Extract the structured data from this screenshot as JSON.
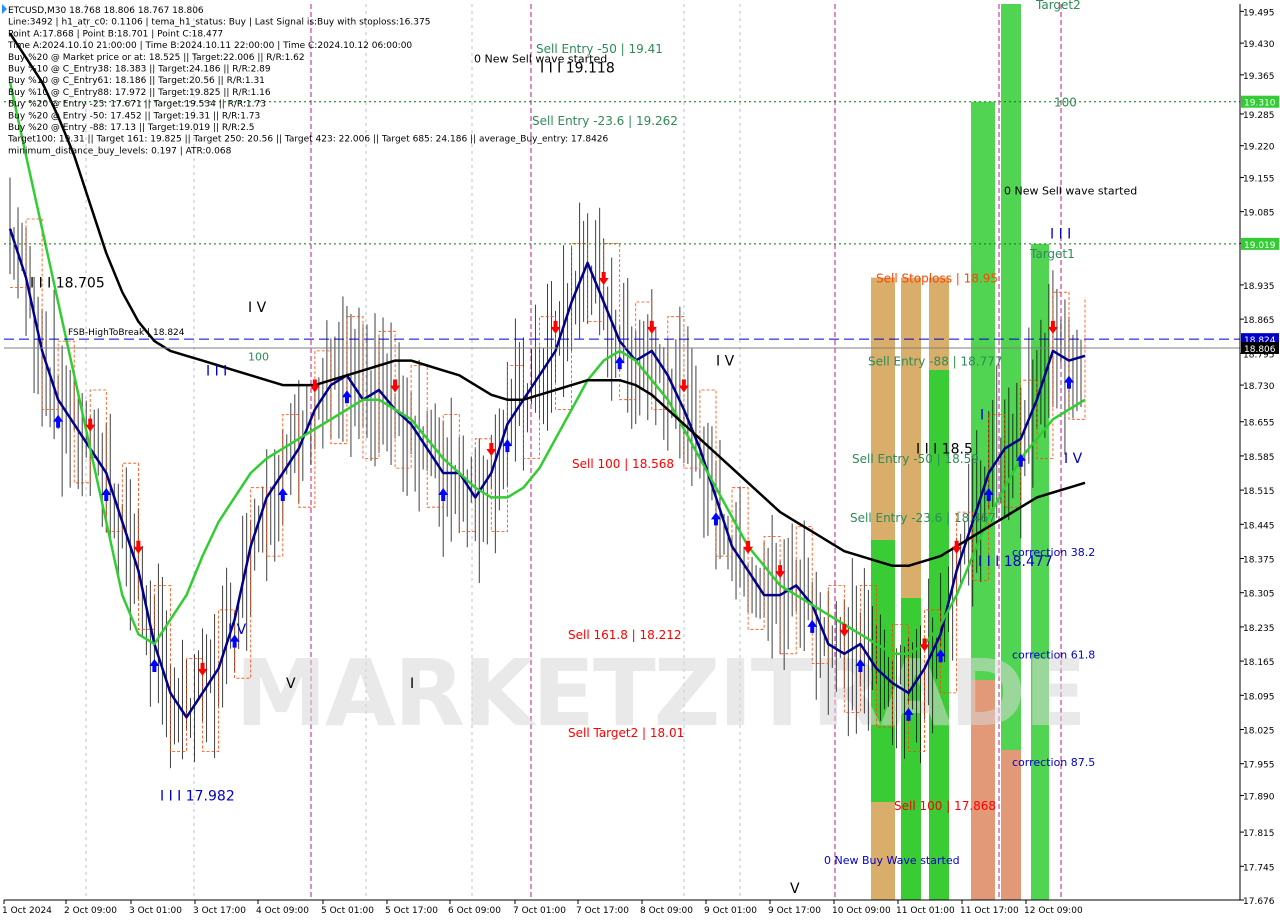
{
  "header": {
    "lines": [
      "ETCUSD,M30  18.768 18.806 18.767 18.806",
      "Line:3492 | h1_atr_c0: 0.1106 | tema_h1_status: Buy | Last Signal is:Buy with stoploss:16.375",
      "Point A:17.868 | Point B:18.701 | Point C:18.477",
      "Time A:2024.10.10 21:00:00 | Time B:2024.10.11 22:00:00 | Time C:2024.10.12 06:00:00",
      "Buy %20 @ Market price or at: 18.525 || Target:22.006 || R/R:1.62",
      "Buy %10 @ C_Entry38: 18.383 || Target:24.186 || R/R:2.89",
      "Buy %10 @ C_Entry61: 18.186 || Target:20.56 || R/R:1.31",
      "Buy %10 @ C_Entry88: 17.972 || Target:19.825 || R/R:1.16",
      "Buy %20 @ Entry -23: 17.671 || Target:19.534 || R/R:1.73",
      "Buy %20 @ Entry -50: 17.452 || Target:19.31 || R/R:1.73",
      "Buy %20 @ Entry -88: 17.13 || Target:19.019 || R/R:2.5",
      "Target100: 19.31 || Target 161: 19.825 || Target 250: 20.56 || Target 423: 22.006 || Target 685: 24.186 || average_Buy_entry: 17.8426",
      "minimum_distance_buy_levels: 0.197 | ATR:0.068"
    ]
  },
  "watermark": "MARKETZITRADE",
  "colors": {
    "bull_candle": "#000000",
    "ma_fast": "#00008b",
    "ma_mid": "#32cd32",
    "ma_slow": "#000000",
    "fractal_line": "#ff4500",
    "level_blue": "#0000cd",
    "level_green": "#008000",
    "zone_green": "#32cd32",
    "zone_orange": "#d2a050",
    "zone_salmon": "#e9967a",
    "separator": "#c71585",
    "arrow_buy": "#0000ff",
    "arrow_sell": "#ff0000"
  },
  "chart_data": {
    "type": "line",
    "symbol": "ETCUSD",
    "timeframe": "M30",
    "ylim": [
      17.676,
      19.51
    ],
    "price_axis": {
      "ticks": [
        "19.495",
        "19.430",
        "19.365",
        "19.285",
        "19.220",
        "19.155",
        "19.085",
        "19.020",
        "18.935",
        "18.865",
        "18.795",
        "18.730",
        "18.655",
        "18.585",
        "18.515",
        "18.445",
        "18.375",
        "18.305",
        "18.235",
        "18.165",
        "18.095",
        "18.025",
        "17.955",
        "17.890",
        "17.815",
        "17.745",
        "17.676"
      ],
      "tick_values": [
        19.495,
        19.43,
        19.365,
        19.285,
        19.22,
        19.155,
        19.085,
        19.02,
        18.935,
        18.865,
        18.795,
        18.73,
        18.655,
        18.585,
        18.515,
        18.445,
        18.375,
        18.305,
        18.235,
        18.165,
        18.095,
        18.025,
        17.955,
        17.89,
        17.815,
        17.745,
        17.676
      ],
      "badges": [
        {
          "text": "19.310",
          "value": 19.31,
          "color": "#32cd32"
        },
        {
          "text": "19.019",
          "value": 19.019,
          "color": "#32cd32"
        },
        {
          "text": "18.824",
          "value": 18.824,
          "color": "#0000cd"
        },
        {
          "text": "18.806",
          "value": 18.806,
          "color": "#000000"
        }
      ]
    },
    "time_axis": {
      "labels": [
        "1 Oct 2024",
        "2 Oct 09:00",
        "3 Oct 01:00",
        "3 Oct 17:00",
        "4 Oct 09:00",
        "5 Oct 01:00",
        "5 Oct 17:00",
        "6 Oct 09:00",
        "7 Oct 01:00",
        "7 Oct 17:00",
        "8 Oct 09:00",
        "9 Oct 01:00",
        "9 Oct 17:00",
        "10 Oct 09:00",
        "11 Oct 01:00",
        "11 Oct 17:00",
        "12 Oct 09:00"
      ]
    },
    "levels": [
      {
        "label": "FSB-HighToBreak | 18.824",
        "value": 18.824,
        "color": "#0000cd",
        "style": "dashed"
      },
      {
        "label": "",
        "value": 19.31,
        "color": "#008000",
        "style": "dotted"
      },
      {
        "label": "",
        "value": 19.019,
        "color": "#008000",
        "style": "dotted"
      },
      {
        "label": "",
        "value": 18.806,
        "color": "#808080",
        "style": "solid"
      }
    ],
    "series": [
      {
        "values": [
          19.05,
          18.95,
          18.8,
          18.7,
          18.65,
          18.6,
          18.55,
          18.45,
          18.35,
          18.2,
          18.1,
          18.05,
          18.1,
          18.15,
          18.25,
          18.4,
          18.5,
          18.55,
          18.6,
          18.68,
          18.73,
          18.75,
          18.7,
          18.72,
          18.68,
          18.65,
          18.6,
          18.55,
          18.55,
          18.5,
          18.55,
          18.65,
          18.7,
          18.75,
          18.8,
          18.9,
          18.98,
          18.9,
          18.82,
          18.78,
          18.8,
          18.75,
          18.68,
          18.6,
          18.5,
          18.4,
          18.35,
          18.3,
          18.3,
          18.32,
          18.28,
          18.2,
          18.18,
          18.2,
          18.15,
          18.12,
          18.1,
          18.15,
          18.22,
          18.35,
          18.45,
          18.55,
          18.6,
          18.62,
          18.7,
          18.8,
          18.78,
          18.79
        ]
      },
      {
        "values": [
          19.35,
          19.2,
          19.05,
          18.9,
          18.75,
          18.6,
          18.45,
          18.3,
          18.22,
          18.2,
          18.25,
          18.3,
          18.38,
          18.45,
          18.5,
          18.55,
          18.58,
          18.6,
          18.62,
          18.64,
          18.66,
          18.68,
          18.7,
          18.7,
          18.68,
          18.66,
          18.62,
          18.58,
          18.55,
          18.52,
          18.5,
          18.5,
          18.52,
          18.56,
          18.62,
          18.68,
          18.74,
          18.78,
          18.8,
          18.78,
          18.74,
          18.7,
          18.64,
          18.58,
          18.52,
          18.46,
          18.4,
          18.36,
          18.32,
          18.3,
          18.28,
          18.26,
          18.24,
          18.22,
          18.2,
          18.18,
          18.18,
          18.2,
          18.24,
          18.3,
          18.38,
          18.46,
          18.52,
          18.58,
          18.62,
          18.66,
          18.68,
          18.7
        ]
      },
      {
        "values": [
          19.45,
          19.4,
          19.35,
          19.28,
          19.2,
          19.1,
          19.0,
          18.92,
          18.86,
          18.82,
          18.8,
          18.79,
          18.78,
          18.77,
          18.76,
          18.75,
          18.74,
          18.73,
          18.73,
          18.73,
          18.74,
          18.75,
          18.76,
          18.77,
          18.78,
          18.78,
          18.77,
          18.76,
          18.75,
          18.73,
          18.71,
          18.7,
          18.7,
          18.71,
          18.72,
          18.73,
          18.74,
          18.74,
          18.74,
          18.73,
          18.71,
          18.68,
          18.65,
          18.62,
          18.59,
          18.56,
          18.53,
          18.5,
          18.47,
          18.45,
          18.43,
          18.41,
          18.39,
          18.38,
          18.37,
          18.36,
          18.36,
          18.37,
          18.38,
          18.4,
          18.42,
          18.44,
          18.46,
          18.48,
          18.5,
          18.51,
          18.52,
          18.53
        ]
      }
    ],
    "zones": [
      {
        "top": 18.95,
        "bottom": 17.676,
        "color": "#d2a050"
      },
      {
        "top": 18.95,
        "bottom": 17.676,
        "color": "#d2a050"
      },
      {
        "top": 18.95,
        "bottom": 17.676,
        "color": "#d2a050"
      },
      {
        "top": 19.31,
        "bottom": 17.676,
        "color": "#32cd32"
      },
      {
        "top": 19.51,
        "bottom": 17.676,
        "color": "#32cd32"
      },
      {
        "top": 19.019,
        "bottom": 17.676,
        "color": "#32cd32"
      }
    ],
    "annotations": [
      {
        "text": "Sell Entry -50 | 19.41",
        "value": 19.41,
        "color": "#2e8b57"
      },
      {
        "text": "0 New Sell wave started",
        "value": 19.39,
        "color": "#000000"
      },
      {
        "text": "I I I 19.118",
        "value": 19.37,
        "color": "#000000"
      },
      {
        "text": "Sell Entry -23.6 | 19.262",
        "value": 19.262,
        "color": "#2e8b57"
      },
      {
        "text": "Target2",
        "value": 19.5,
        "color": "#2e8b57"
      },
      {
        "text": "100",
        "value": 19.3,
        "color": "#2e8b57"
      },
      {
        "text": "0 New Sell wave started",
        "value": 19.12,
        "color": "#000000"
      },
      {
        "text": "I I I",
        "value": 19.03,
        "color": "#0000cd"
      },
      {
        "text": "Target1",
        "value": 18.99,
        "color": "#2e8b57"
      },
      {
        "text": "I I I 18.705",
        "value": 18.93,
        "color": "#000000"
      },
      {
        "text": "I V",
        "value": 18.88,
        "color": "#000000"
      },
      {
        "text": "Sell Stoploss | 18.95",
        "value": 18.94,
        "color": "#ff4500"
      },
      {
        "text": "100",
        "value": 18.78,
        "color": "#2e8b57"
      },
      {
        "text": "I I I",
        "value": 18.75,
        "color": "#0000cd"
      },
      {
        "text": "I V",
        "value": 18.77,
        "color": "#000000"
      },
      {
        "text": "Sell Entry -88 | 18.777",
        "value": 18.77,
        "color": "#2e8b57"
      },
      {
        "text": "I",
        "value": 18.66,
        "color": "#0000cd"
      },
      {
        "text": "Sell 100 | 18.568",
        "value": 18.56,
        "color": "#ff0000"
      },
      {
        "text": "I I I 18.5",
        "value": 18.59,
        "color": "#000000"
      },
      {
        "text": "Sell Entry -50 | 18.59",
        "value": 18.57,
        "color": "#2e8b57"
      },
      {
        "text": "I V",
        "value": 18.57,
        "color": "#0000cd"
      },
      {
        "text": "Sell Entry -23.6 | 18.467",
        "value": 18.45,
        "color": "#2e8b57"
      },
      {
        "text": "correction 38.2",
        "value": 18.38,
        "color": "#0000cd"
      },
      {
        "text": "I I I 18.477",
        "value": 18.36,
        "color": "#0000cd"
      },
      {
        "text": "I V",
        "value": 18.22,
        "color": "#0000cd"
      },
      {
        "text": "Sell 161.8 | 18.212",
        "value": 18.21,
        "color": "#ff0000"
      },
      {
        "text": "correction 61.8",
        "value": 18.17,
        "color": "#0000cd"
      },
      {
        "text": "V",
        "value": 18.11,
        "color": "#000000"
      },
      {
        "text": "I",
        "value": 18.11,
        "color": "#000000"
      },
      {
        "text": "Sell Target2 | 18.01",
        "value": 18.01,
        "color": "#ff0000"
      },
      {
        "text": "correction 87.5",
        "value": 17.95,
        "color": "#0000cd"
      },
      {
        "text": "I I I 17.982",
        "value": 17.88,
        "color": "#0000cd"
      },
      {
        "text": "Sell 100 | 17.868",
        "value": 17.86,
        "color": "#ff0000"
      },
      {
        "text": "0 New Buy Wave started",
        "value": 17.75,
        "color": "#0000cd"
      },
      {
        "text": "V",
        "value": 17.69,
        "color": "#000000"
      }
    ]
  }
}
